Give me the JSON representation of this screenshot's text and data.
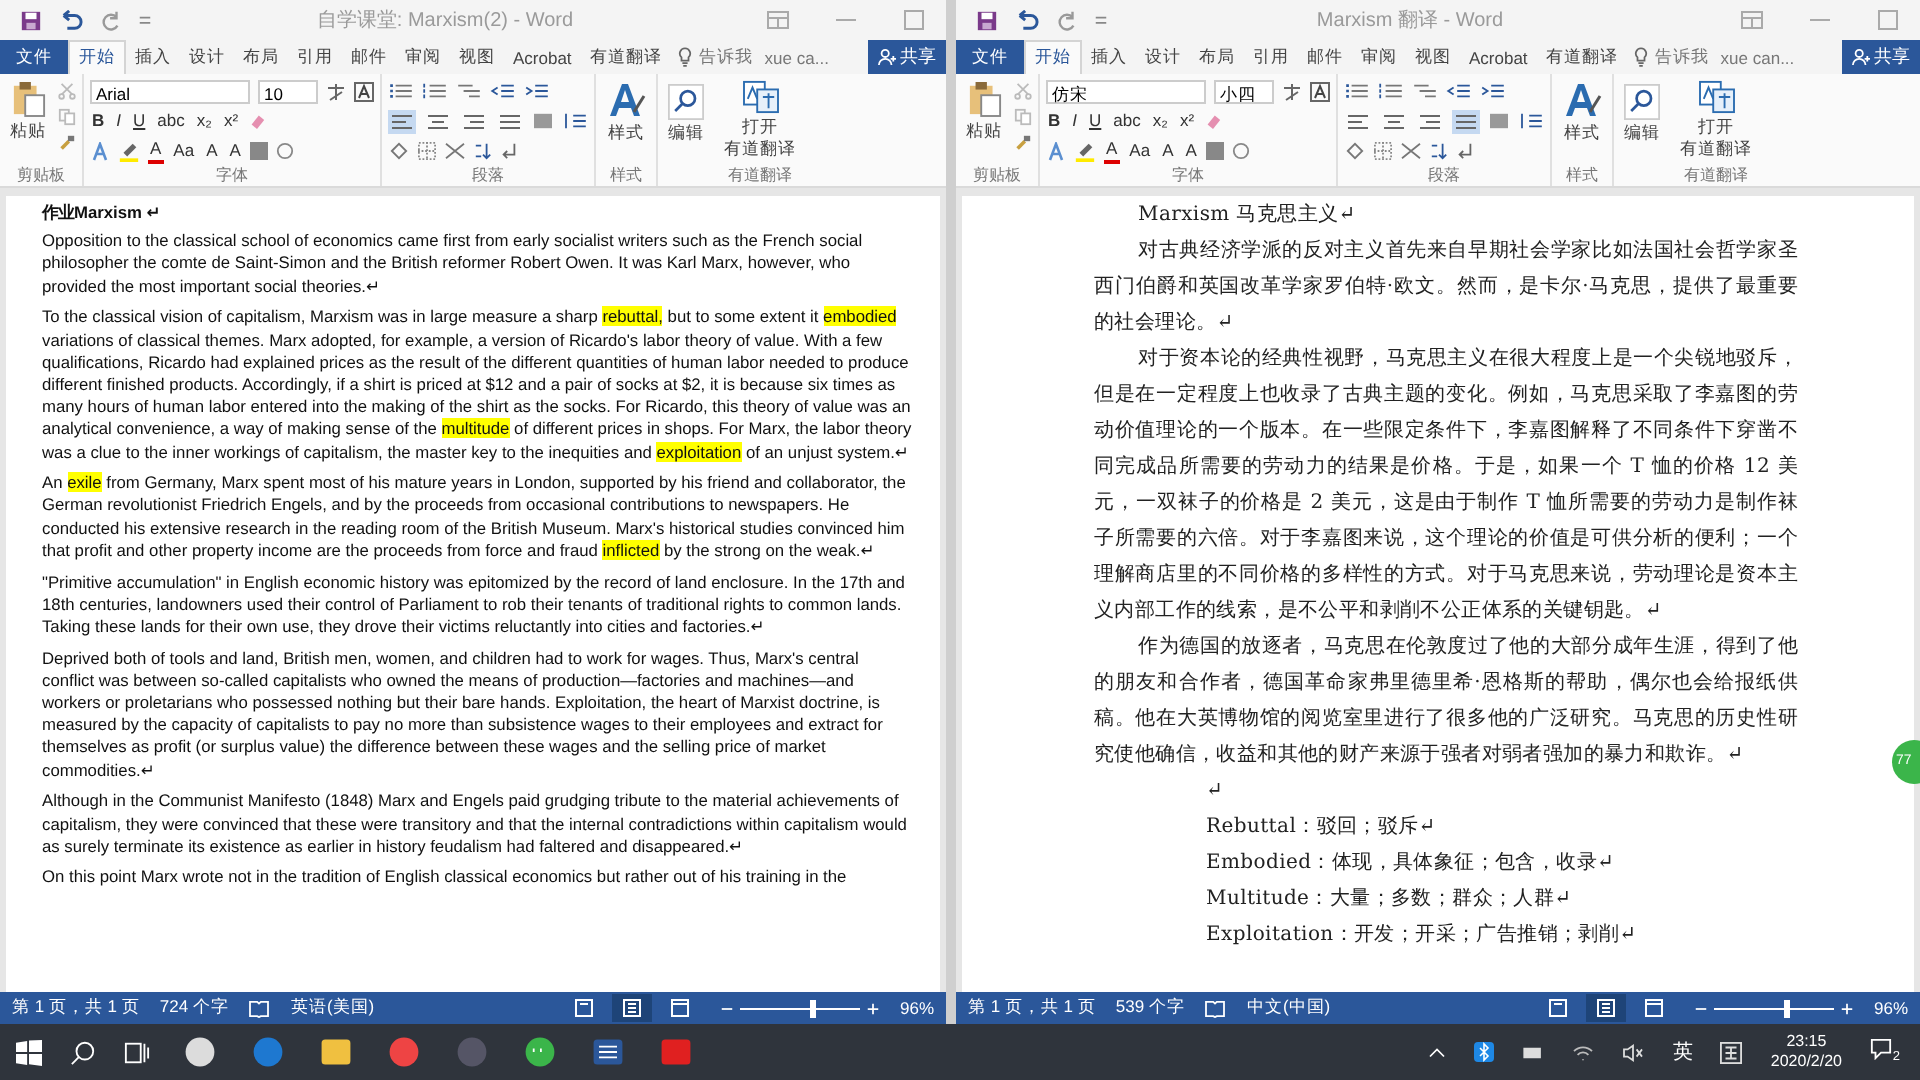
{
  "windows": [
    {
      "title": "自学课堂: Marxism(2) - Word",
      "tabs": [
        {
          "label": "文件",
          "kind": "file",
          "selected": false
        },
        {
          "label": "开始",
          "kind": "tab",
          "selected": true
        },
        {
          "label": "插入",
          "kind": "tab",
          "selected": false
        },
        {
          "label": "设计",
          "kind": "tab",
          "selected": false
        },
        {
          "label": "布局",
          "kind": "tab",
          "selected": false
        },
        {
          "label": "引用",
          "kind": "tab",
          "selected": false
        },
        {
          "label": "邮件",
          "kind": "tab",
          "selected": false
        },
        {
          "label": "审阅",
          "kind": "tab",
          "selected": false
        },
        {
          "label": "视图",
          "kind": "tab",
          "selected": false
        },
        {
          "label": "Acrobat",
          "kind": "tab",
          "selected": false
        },
        {
          "label": "有道翻译",
          "kind": "tab",
          "selected": false
        }
      ],
      "tell_me": "告诉我",
      "user": "xue ca...",
      "share": "共享",
      "ribbon": {
        "paste": "粘贴",
        "clipboard_group": "剪贴板",
        "font_name": "Arial",
        "font_size": "10",
        "font_row_2": [
          "B",
          "I",
          "U",
          "abc",
          "x₂",
          "x²"
        ],
        "font_row_3": [
          {
            "label": "A",
            "kind": "color"
          },
          {
            "label": "Aa",
            "kind": "plain"
          },
          {
            "label": "A",
            "kind": "plain"
          },
          {
            "label": "A",
            "kind": "plain"
          }
        ],
        "font_group": "字体",
        "alignments": [
          {
            "selected": true
          },
          {
            "selected": false
          },
          {
            "selected": false
          },
          {
            "selected": false
          }
        ],
        "paragraph_group": "段落",
        "styles": "样式",
        "styles_group": "样式",
        "editing": "编辑",
        "youdao": [
          "打开",
          "有道翻译"
        ],
        "youdao_group": "有道翻译"
      },
      "document": {
        "kind": "english",
        "paragraphs": [
          {
            "kind": "heading",
            "segments": [
              {
                "text": "作业Marxism ↵",
                "highlighted": false
              }
            ]
          },
          {
            "kind": "para",
            "segments": [
              {
                "text": "Opposition to the classical school of economics came first from early socialist writers such as the French social philosopher the comte de Saint-Simon and the British reformer Robert Owen. It was Karl Marx, however, who provided the most important social theories.↵",
                "highlighted": false
              }
            ]
          },
          {
            "kind": "para",
            "segments": [
              {
                "text": "To the classical vision of capitalism, Marxism was in large measure a sharp ",
                "highlighted": false
              },
              {
                "text": "rebuttal,",
                "highlighted": true
              },
              {
                "text": " but to some extent it ",
                "highlighted": false
              },
              {
                "text": "embodied",
                "highlighted": true
              },
              {
                "text": " variations of classical themes. Marx adopted, for example, a version of Ricardo's labor theory of value. With a few qualifications, Ricardo had explained prices as the result of the different quantities of human labor needed to produce different finished products. Accordingly, if a shirt is priced at $12 and a pair of socks at $2, it is because six times as many hours of human labor entered into the making of the shirt as the socks. For Ricardo, this theory of value was an analytical convenience, a way of making sense of the ",
                "highlighted": false
              },
              {
                "text": "multitude",
                "highlighted": true
              },
              {
                "text": " of different prices in shops. For Marx, the labor theory was a clue to the inner workings of capitalism, the master key to the inequities and ",
                "highlighted": false
              },
              {
                "text": "exploitation",
                "highlighted": true
              },
              {
                "text": " of an unjust system.↵",
                "highlighted": false
              }
            ]
          },
          {
            "kind": "para",
            "segments": [
              {
                "text": "An ",
                "highlighted": false
              },
              {
                "text": "exile",
                "highlighted": true
              },
              {
                "text": " from Germany, Marx spent most of his mature years in London, supported by his friend and collaborator, the German revolutionist Friedrich Engels, and by the proceeds from occasional contributions to newspapers. He conducted his extensive research in the reading room of the British Museum. Marx's historical studies convinced him that profit and other property income are the proceeds from force and fraud ",
                "highlighted": false
              },
              {
                "text": "inflicted",
                "highlighted": true
              },
              {
                "text": " by the strong on the weak.↵",
                "highlighted": false
              }
            ]
          },
          {
            "kind": "para",
            "segments": [
              {
                "text": "\"Primitive accumulation\" in English economic history was epitomized by the record of land enclosure. In the 17th and 18th centuries, landowners used their control of Parliament to rob their tenants of traditional rights to common lands. Taking these lands for their own use, they drove their victims reluctantly into cities and factories.↵",
                "highlighted": false
              }
            ]
          },
          {
            "kind": "para",
            "segments": [
              {
                "text": "Deprived both of tools and land, British men, women, and children had to work for wages. Thus, Marx's central conflict was between so-called capitalists who owned the means of production—factories and machines—and workers or proletarians who possessed nothing but their bare hands. Exploitation, the heart of Marxist doctrine, is measured by the capacity of capitalists to pay no more than subsistence wages to their employees and extract for themselves as profit (or surplus value) the difference between these wages and the selling price of market commodities.↵",
                "highlighted": false
              }
            ]
          },
          {
            "kind": "para",
            "segments": [
              {
                "text": "Although in the Communist Manifesto (1848) Marx and Engels paid grudging tribute to the material achievements of capitalism, they were convinced that these were transitory and that the internal contradictions within capitalism would as surely terminate its existence as earlier in history feudalism had faltered and disappeared.↵",
                "highlighted": false
              }
            ]
          },
          {
            "kind": "para",
            "segments": [
              {
                "text": "On this point Marx wrote not in the tradition of English classical economics but rather out of his training in the",
                "highlighted": false
              }
            ]
          }
        ]
      },
      "status": {
        "page": "第 1 页，共 1 页",
        "words": "724 个字",
        "language": "英语(美国)",
        "views": [
          {
            "selected": false
          },
          {
            "selected": true
          },
          {
            "selected": false
          }
        ],
        "zoom_slider": {
          "level": 0.6
        },
        "zoom": "96%"
      }
    },
    {
      "title": "Marxism 翻译 - Word",
      "tabs": [
        {
          "label": "文件",
          "kind": "file",
          "selected": false
        },
        {
          "label": "开始",
          "kind": "tab",
          "selected": true
        },
        {
          "label": "插入",
          "kind": "tab",
          "selected": false
        },
        {
          "label": "设计",
          "kind": "tab",
          "selected": false
        },
        {
          "label": "布局",
          "kind": "tab",
          "selected": false
        },
        {
          "label": "引用",
          "kind": "tab",
          "selected": false
        },
        {
          "label": "邮件",
          "kind": "tab",
          "selected": false
        },
        {
          "label": "审阅",
          "kind": "tab",
          "selected": false
        },
        {
          "label": "视图",
          "kind": "tab",
          "selected": false
        },
        {
          "label": "Acrobat",
          "kind": "tab",
          "selected": false
        },
        {
          "label": "有道翻译",
          "kind": "tab",
          "selected": false
        }
      ],
      "tell_me": "告诉我",
      "user": "xue can...",
      "share": "共享",
      "ribbon": {
        "paste": "粘贴",
        "clipboard_group": "剪贴板",
        "font_name": "仿宋",
        "font_size": "小四",
        "font_row_2": [
          "B",
          "I",
          "U",
          "abc",
          "x₂",
          "x²"
        ],
        "font_row_3": [
          {
            "label": "A",
            "kind": "color"
          },
          {
            "label": "Aa",
            "kind": "plain"
          },
          {
            "label": "A",
            "kind": "plain"
          },
          {
            "label": "A",
            "kind": "plain"
          }
        ],
        "font_group": "字体",
        "alignments": [
          {
            "selected": false
          },
          {
            "selected": false
          },
          {
            "selected": false
          },
          {
            "selected": true
          }
        ],
        "paragraph_group": "段落",
        "styles": "样式",
        "styles_group": "样式",
        "editing": "编辑",
        "youdao": [
          "打开",
          "有道翻译"
        ],
        "youdao_group": "有道翻译"
      },
      "document": {
        "kind": "chinese",
        "paragraphs": [
          {
            "kind": "para",
            "segments": [
              {
                "text": "Marxism 马克思主义↵",
                "highlighted": false
              }
            ]
          },
          {
            "kind": "para",
            "segments": [
              {
                "text": "对古典经济学派的反对主义首先来自早期社会学家比如法国社会哲学家圣西门伯爵和英国改革学家罗伯特·欧文。然而，是卡尔·马克思，提供了最重要的社会理论。↵",
                "highlighted": false
              }
            ]
          },
          {
            "kind": "para",
            "segments": [
              {
                "text": "对于资本论的经典性视野，马克思主义在很大程度上是一个尖锐地驳斥，但是在一定程度上也收录了古典主题的变化。例如，马克思采取了李嘉图的劳动价值理论的一个版本。在一些限定条件下，李嘉图解释了不同条件下穿凿不同完成品所需要的劳动力的结果是价格。于是，如果一个 T 恤的价格 12 美元，一双袜子的价格是 2 美元，这是由于制作 T 恤所需要的劳动力是制作袜子所需要的六倍。对于李嘉图来说，这个理论的价值是可供分析的便利；一个理解商店里的不同价格的多样性的方式。对于马克思来说，劳动理论是资本主义内部工作的线索，是不公平和剥削不公正体系的关键钥匙。↵",
                "highlighted": false
              }
            ]
          },
          {
            "kind": "para",
            "segments": [
              {
                "text": "作为德国的放逐者，马克思在伦敦度过了他的大部分成年生涯，得到了他的朋友和合作者，德国革命家弗里德里希·恩格斯的帮助，偶尔也会给报纸供稿。他在大英博物馆的阅览室里进行了很多他的广泛研究。马克思的历史性研究使他确信，收益和其他的财产来源于强者对弱者强加的暴力和欺诈。↵",
                "highlighted": false
              }
            ]
          },
          {
            "kind": "term",
            "segments": [
              {
                "text": "↵",
                "highlighted": false
              }
            ]
          },
          {
            "kind": "term",
            "segments": [
              {
                "text": "Rebuttal：驳回；驳斥↵",
                "highlighted": false
              }
            ]
          },
          {
            "kind": "term",
            "segments": [
              {
                "text": "Embodied：体现，具体象征；包含，收录↵",
                "highlighted": false
              }
            ]
          },
          {
            "kind": "term",
            "segments": [
              {
                "text": "Multitude：大量；多数；群众；人群↵",
                "highlighted": false
              }
            ]
          },
          {
            "kind": "term",
            "segments": [
              {
                "text": "Exploitation：开发；开采；广告推销；剥削↵",
                "highlighted": false
              }
            ]
          }
        ]
      },
      "status": {
        "page": "第 1 页，共 1 页",
        "words": "539 个字",
        "language": "中文(中国)",
        "views": [
          {
            "selected": false
          },
          {
            "selected": true
          },
          {
            "selected": false
          }
        ],
        "zoom_slider": {
          "level": 0.6
        },
        "zoom": "96%"
      }
    }
  ],
  "float_badge": "77",
  "taskbar": {
    "apps": [
      {
        "kind": "pinwheel"
      },
      {
        "kind": "edge"
      },
      {
        "kind": "folder"
      },
      {
        "kind": "chrome"
      },
      {
        "kind": "globe"
      },
      {
        "kind": "chat"
      },
      {
        "kind": "word"
      },
      {
        "kind": "dict"
      }
    ],
    "language": "英",
    "time": "23:15",
    "date": "2020/2/20",
    "notifications": "2"
  }
}
